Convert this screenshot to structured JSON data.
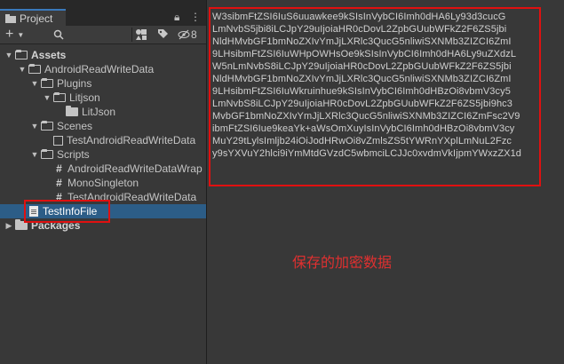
{
  "tab": {
    "label": "Project"
  },
  "toolbar": {
    "add_label": "+",
    "hidden_count": "8"
  },
  "tree": [
    {
      "label": "Assets"
    },
    {
      "label": "AndroidReadWriteData"
    },
    {
      "label": "Plugins"
    },
    {
      "label": "Litjson"
    },
    {
      "label": "LitJson"
    },
    {
      "label": "Scenes"
    },
    {
      "label": "TestAndroidReadWriteData"
    },
    {
      "label": "Scripts"
    },
    {
      "label": "AndroidReadWriteDataWrap"
    },
    {
      "label": "MonoSingleton"
    },
    {
      "label": "TestAndroidReadWriteData"
    },
    {
      "label": "TestInfoFile"
    },
    {
      "label": "Packages"
    }
  ],
  "content_lines": [
    "W3sibmFtZSI6IuS6uuawkee9kSIsInVybCI6Imh0dHA6Ly93d3cucG",
    "LmNvbS5jbi8iLCJpY29uIjoiaHR0cDovL2ZpbGUubWFkZ2F6ZS5jbi",
    "NldHMvbGF1bmNoZXIvYmJjLXRlc3QucG5nliwiSXNMb3ZIZCI6ZmI",
    "9LHsibmFtZSI6IuWHpOWHsOe9kSIsInVybCI6Imh0dHA6Ly9uZXdzL",
    "W5nLmNvbS8iLCJpY29uIjoiaHR0cDovL2ZpbGUubWFkZ2F6ZS5jbi",
    "NldHMvbGF1bmNoZXIvYmJjLXRlc3QucG5nliwiSXNMb3ZIZCI6ZmI",
    "9LHsibmFtZSI6IuWkruinhue9kSIsInVybCI6Imh0dHBzOi8vbmV3cy5",
    "LmNvbS8iLCJpY29uIjoiaHR0cDovL2ZpbGUubWFkZ2F6ZS5jbi9hc3",
    "MvbGF1bmNoZXIvYmJjLXRlc3QucG5nliwiSXNMb3ZIZCI6ZmFsc2V9",
    "ibmFtZSI6Iue9keaYk+aWsOmXuyIsInVybCI6Imh0dHBzOi8vbmV3cy",
    "MuY29tLylsImljb24iOiJodHRwOi8vZmlsZS5tYWRnYXplLmNuL2Fzc",
    "y9sYXVuY2hlci9iYmMtdGVzdC5wbmciLCJJc0xvdmVkIjpmYWxzZX1d"
  ],
  "caption": "保存的加密数据"
}
